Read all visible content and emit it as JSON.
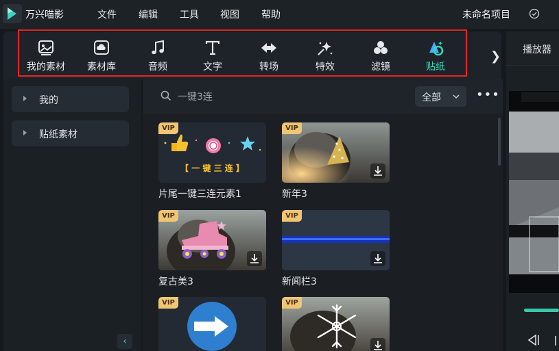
{
  "app": {
    "name": "万兴喵影"
  },
  "menu": [
    "文件",
    "编辑",
    "工具",
    "视图",
    "帮助"
  ],
  "project": {
    "name": "未命名项目"
  },
  "toolbar": {
    "items": [
      {
        "label": "我的素材",
        "icon": "my-media-icon",
        "active": false
      },
      {
        "label": "素材库",
        "icon": "stock-library-icon",
        "active": false
      },
      {
        "label": "音频",
        "icon": "audio-note-icon",
        "active": false
      },
      {
        "label": "文字",
        "icon": "text-t-icon",
        "active": false
      },
      {
        "label": "转场",
        "icon": "transition-icon",
        "active": false
      },
      {
        "label": "特效",
        "icon": "effects-sparkle-icon",
        "active": false
      },
      {
        "label": "滤镜",
        "icon": "filter-circles-icon",
        "active": false
      },
      {
        "label": "贴纸",
        "icon": "sticker-icon",
        "active": true
      }
    ],
    "more": "❯"
  },
  "sidebar": {
    "items": [
      {
        "label": "我的"
      },
      {
        "label": "贴纸素材"
      }
    ]
  },
  "search": {
    "placeholder": "一键3连"
  },
  "filter": {
    "selected": "全部"
  },
  "cards": [
    {
      "title": "片尾一键三连元素1",
      "vip": "VIP",
      "downloadable": false,
      "thumb_caption": "【 一 键 三 连 】"
    },
    {
      "title": "新年3",
      "vip": "VIP",
      "downloadable": true
    },
    {
      "title": "复古美3",
      "vip": "VIP",
      "downloadable": true
    },
    {
      "title": "新闻栏3",
      "vip": "VIP",
      "downloadable": true
    },
    {
      "title": "",
      "vip": "VIP",
      "downloadable": false
    },
    {
      "title": "",
      "vip": "VIP",
      "downloadable": true
    }
  ],
  "player": {
    "tab": "播放器"
  },
  "colors": {
    "accent": "#34d7b9",
    "vip": "#f0c574",
    "highlight": "#e02828"
  }
}
